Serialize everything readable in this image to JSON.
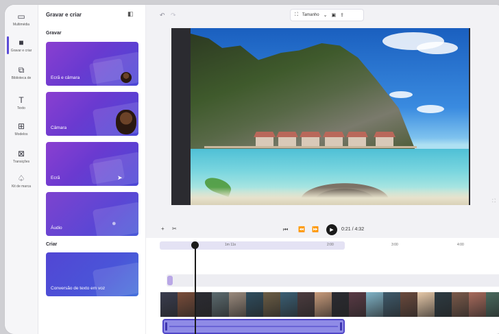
{
  "rail": {
    "items": [
      {
        "label": "Multimédia",
        "icon": "folder-icon",
        "glyph": "▭"
      },
      {
        "label": "Gravar e criar",
        "icon": "camera-icon",
        "glyph": "■"
      },
      {
        "label": "Biblioteca de",
        "icon": "library-icon",
        "glyph": "⧉"
      },
      {
        "label": "Texto",
        "icon": "text-icon",
        "glyph": "T"
      },
      {
        "label": "Modelos",
        "icon": "templates-icon",
        "glyph": "⊞"
      },
      {
        "label": "Transições",
        "icon": "transitions-icon",
        "glyph": "⊠"
      },
      {
        "label": "Kit de marca",
        "icon": "brand-kit-icon",
        "glyph": "♤"
      }
    ]
  },
  "panel": {
    "title": "Gravar e criar",
    "section_record": "Gravar",
    "section_create": "Criar",
    "cards": [
      {
        "label": "Ecrã e câmara"
      },
      {
        "label": "Câmara"
      },
      {
        "label": "Ecrã"
      },
      {
        "label": "Áudio"
      },
      {
        "label": "Conversão de texto em voz"
      }
    ]
  },
  "topbar": {
    "size_label": "Tamanho",
    "size_glyph": "⛶",
    "chevron": "⌄",
    "media_glyph": "▣",
    "export_glyph": "⇪",
    "undo_glyph": "↶",
    "redo_glyph": "↷"
  },
  "playback": {
    "time": "0:21 / 4:32",
    "play_glyph": "▶",
    "skip_back_glyph": "⏮",
    "rewind_glyph": "⏪",
    "forward_glyph": "⏩",
    "add_glyph": "+",
    "split_glyph": "✂"
  },
  "timeline": {
    "ruler": [
      "1m 11s",
      "2:00",
      "3:00",
      "4:00"
    ],
    "frame_colors": [
      "#3a3d4f",
      "#7a4d3a",
      "#2c2c33",
      "#5c6b6f",
      "#9a8a7d",
      "#2f4d5e",
      "#6b5d45",
      "#3b5f74",
      "#4c3c3f",
      "#c79a7a",
      "#2b2b31",
      "#5a3a45",
      "#7fb2c6",
      "#3f5a6b",
      "#6b4a3d",
      "#e6c8a8",
      "#2e3b42",
      "#7b5a4a",
      "#a86b5c",
      "#4a6a5e"
    ]
  },
  "colors": {
    "accent": "#5b4bd6",
    "audio_clip": "#8f8be6"
  }
}
